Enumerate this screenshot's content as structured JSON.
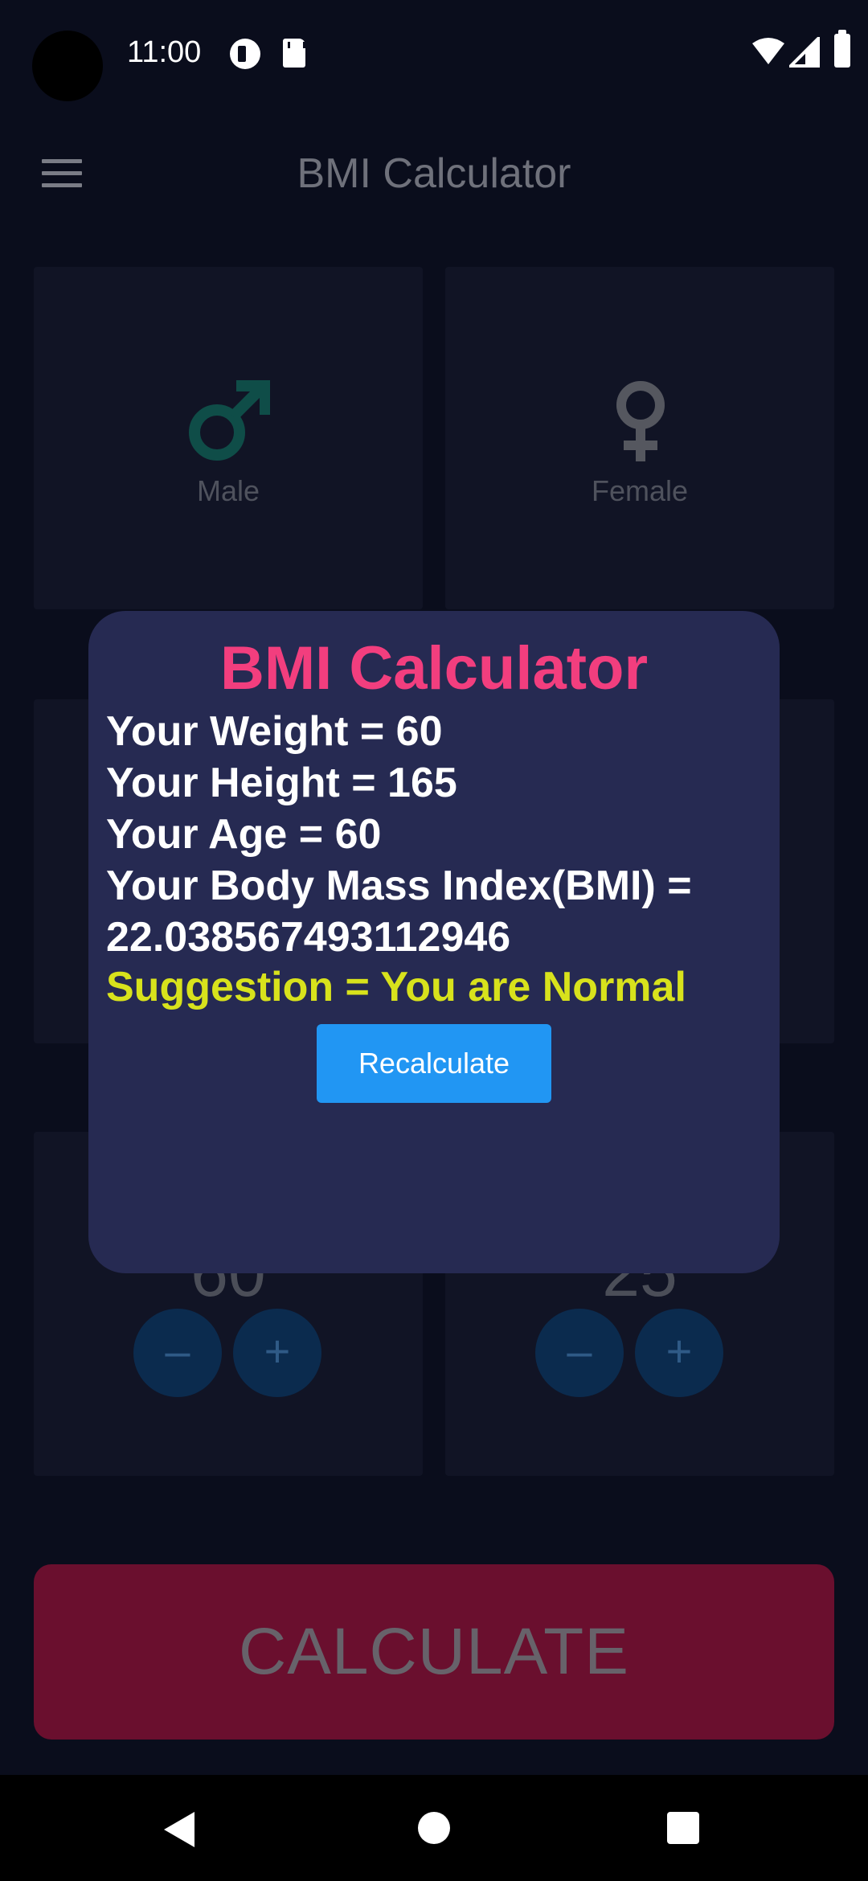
{
  "status_bar": {
    "time": "11:00"
  },
  "app_bar": {
    "title": "BMI Calculator"
  },
  "gender": {
    "male_label": "Male",
    "female_label": "Female"
  },
  "weight_card": {
    "value": "60",
    "minus": "–",
    "plus": "+"
  },
  "age_card": {
    "value": "25",
    "minus": "–",
    "plus": "+"
  },
  "calculate_button": {
    "label": "CALCULATE"
  },
  "dialog": {
    "title": "BMI Calculator",
    "weight_line": "Your Weight = 60",
    "height_line": "Your Height = 165",
    "age_line": "Your Age = 60",
    "bmi_label_line": "Your Body Mass Index(BMI) =",
    "bmi_value_line": "22.038567493112946",
    "suggestion_line": "Suggestion = You are Normal",
    "recalculate_label": "Recalculate"
  },
  "colors": {
    "background": "#0a0d1c",
    "dialog": "#262a52",
    "dialog_title": "#f23e7e",
    "suggestion": "#d8e21c",
    "recalculate_button": "#2196f3",
    "calculate_button": "#6a0f2e"
  },
  "icons": [
    "menu-icon",
    "male-icon",
    "female-icon",
    "wifi-icon",
    "signal-icon",
    "battery-icon",
    "back-icon",
    "home-icon",
    "recents-icon"
  ]
}
